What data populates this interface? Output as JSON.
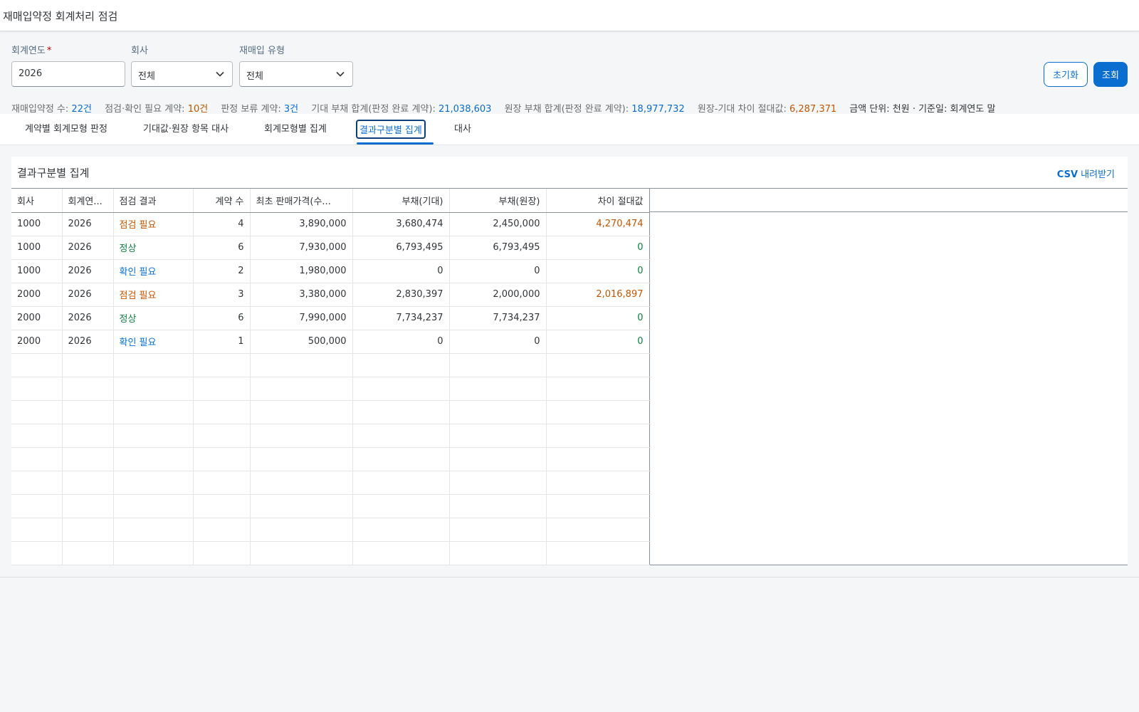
{
  "page": {
    "title": "재매입약정 회계처리 점검"
  },
  "filters": {
    "year": {
      "label": "회계연도",
      "required_mark": "*",
      "value": "2026"
    },
    "company": {
      "label": "회사",
      "value": "전체"
    },
    "type": {
      "label": "재매입 유형",
      "value": "전체"
    }
  },
  "buttons": {
    "reset": "초기화",
    "search": "조회"
  },
  "summary": {
    "count_label": "재매입약정 수:",
    "count_value": "22건",
    "check_label": "점검·확인 필요 계약:",
    "check_value": "10건",
    "hold_label": "판정 보류 계약:",
    "hold_value": "3건",
    "expected_label": "기대 부채 합계(판정 완료 계약):",
    "expected_value": "21,038,603",
    "ledger_label": "원장 부채 합계(판정 완료 계약):",
    "ledger_value": "18,977,732",
    "diff_label": "원장-기대 차이 절대값:",
    "diff_value": "6,287,371",
    "unit_note": "금액 단위: 천원 · 기준일: 회계연도 말"
  },
  "tabs": [
    {
      "label": "계약별 회계모형 판정"
    },
    {
      "label": "기대값·원장 항목 대사"
    },
    {
      "label": "회계모형별 집계"
    },
    {
      "label": "결과구분별 집계",
      "active": true
    },
    {
      "label": "대사"
    }
  ],
  "panel": {
    "title": "결과구분별 집계",
    "csv_prefix": "CSV",
    "csv_suffix": " 내려받기"
  },
  "table": {
    "columns": [
      "회사",
      "회계연...",
      "점검 결과",
      "계약 수",
      "최초 판매가격(수...",
      "부채(기대)",
      "부채(원장)",
      "차이 절대값"
    ],
    "rows": [
      {
        "company": "1000",
        "year": "2026",
        "result": "점검 필요",
        "result_color": "orange",
        "count": "4",
        "price": "3,890,000",
        "expected": "3,680,474",
        "ledger": "2,450,000",
        "diff": "4,270,474",
        "diff_color": "orange"
      },
      {
        "company": "1000",
        "year": "2026",
        "result": "정상",
        "result_color": "green",
        "count": "6",
        "price": "7,930,000",
        "expected": "6,793,495",
        "ledger": "6,793,495",
        "diff": "0",
        "diff_color": "green"
      },
      {
        "company": "1000",
        "year": "2026",
        "result": "확인 필요",
        "result_color": "blue",
        "count": "2",
        "price": "1,980,000",
        "expected": "0",
        "ledger": "0",
        "diff": "0",
        "diff_color": "green"
      },
      {
        "company": "2000",
        "year": "2026",
        "result": "점검 필요",
        "result_color": "orange",
        "count": "3",
        "price": "3,380,000",
        "expected": "2,830,397",
        "ledger": "2,000,000",
        "diff": "2,016,897",
        "diff_color": "orange"
      },
      {
        "company": "2000",
        "year": "2026",
        "result": "정상",
        "result_color": "green",
        "count": "6",
        "price": "7,990,000",
        "expected": "7,734,237",
        "ledger": "7,734,237",
        "diff": "0",
        "diff_color": "green"
      },
      {
        "company": "2000",
        "year": "2026",
        "result": "확인 필요",
        "result_color": "blue",
        "count": "1",
        "price": "500,000",
        "expected": "0",
        "ledger": "0",
        "diff": "0",
        "diff_color": "green"
      }
    ]
  }
}
